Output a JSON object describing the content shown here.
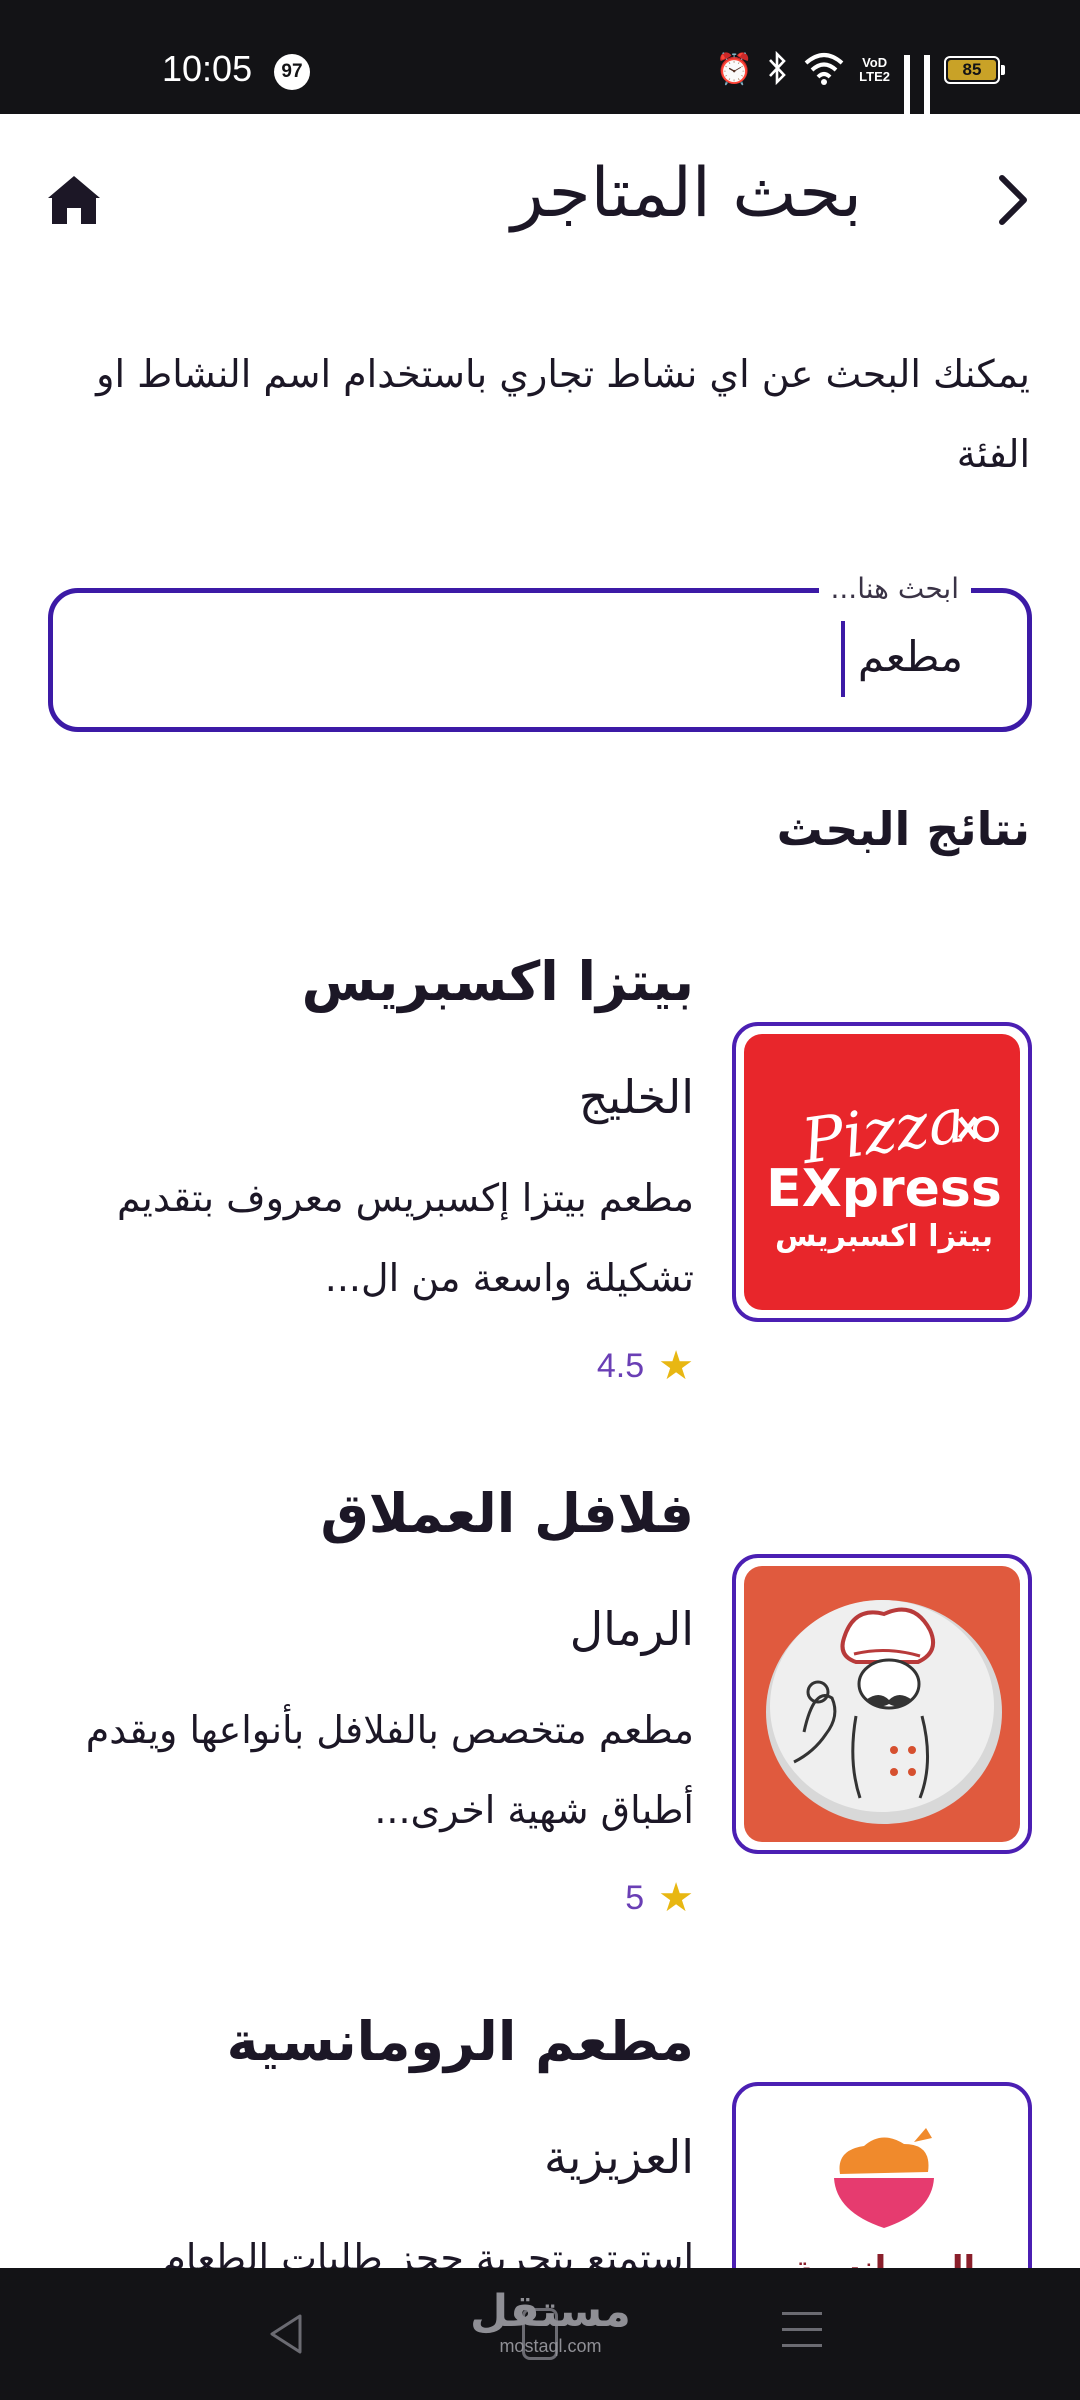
{
  "status_bar": {
    "time": "10:05",
    "notification_count": "97",
    "battery": "85"
  },
  "header": {
    "title": "بحث المتاجر",
    "home_icon": "home-icon",
    "back_icon": "chevron-right-icon"
  },
  "intro_text": "يمكنك البحث عن اي نشاط تجاري باستخدام اسم النشاط او الفئة",
  "search": {
    "label": "ابحث هنا...",
    "value": "مطعم"
  },
  "results_title": "نتائج البحث",
  "results": [
    {
      "name": "بيتزا اكسبريس",
      "area": "الخليج",
      "description": "مطعم بيتزا إكسبريس معروف بتقديم تشكيلة واسعة من ال...",
      "rating": "4.5",
      "logo": {
        "line1": "Pizza",
        "line2": "EXpress",
        "arabic": "بيتزا اكسبريس",
        "bg": "#e8262b"
      }
    },
    {
      "name": "فلافل العملاق",
      "area": "الرمال",
      "description": "مطعم متخصص بالفلافل بأنواعها ويقدم أطباق شهية اخرى...",
      "rating": "5",
      "logo": {
        "bg": "#e05a3e"
      }
    },
    {
      "name": "مطعم الرومانسية",
      "area": "العزيزية",
      "description": "استمتع بتجربة حجز طلبات الطعام",
      "logo": {
        "arabic": "الرومانسية",
        "bg": "#ffffff"
      }
    }
  ],
  "watermark": {
    "arabic": "مستقل",
    "latin": "mostaql.com"
  },
  "colors": {
    "accent": "#3c1aa6",
    "star": "#e8b712",
    "rating_text": "#6a3fb5"
  }
}
